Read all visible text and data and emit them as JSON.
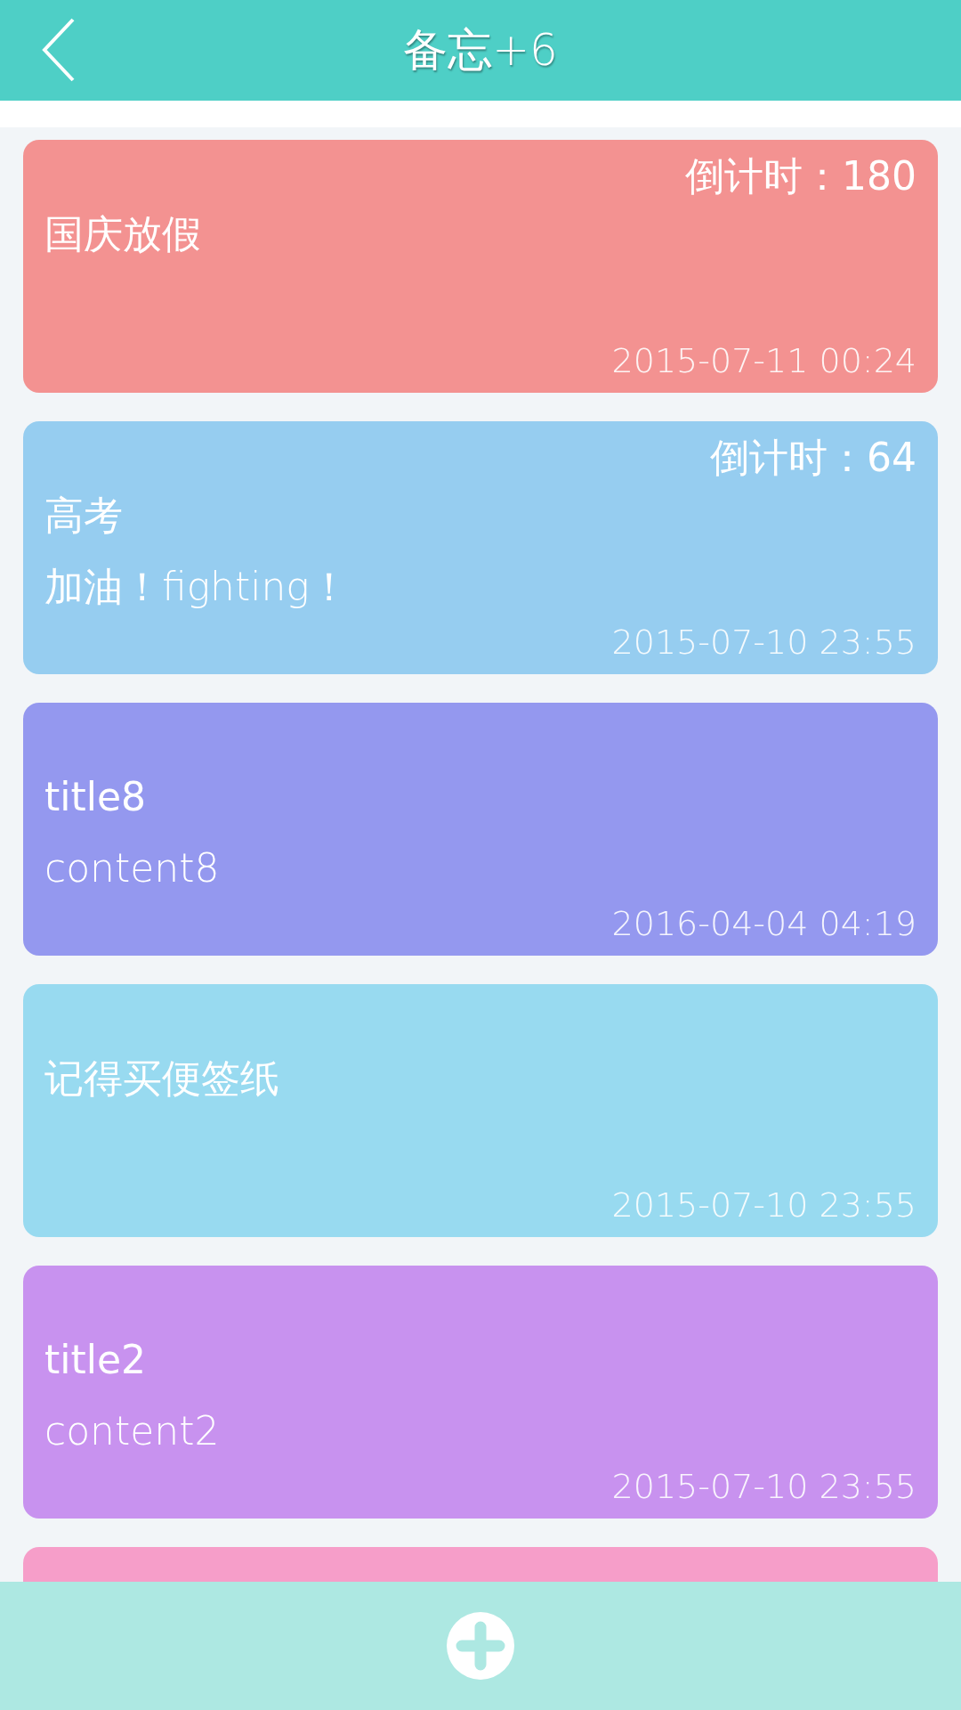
{
  "header": {
    "title": "备忘",
    "count": "+6"
  },
  "notes": [
    {
      "color": "#f39291",
      "countdown": "倒计时：180",
      "title": "国庆放假",
      "date": "2015-07-11 00:24"
    },
    {
      "color": "#96cdf0",
      "countdown": "倒计时：64",
      "title": "高考",
      "content": "加油！fighting！",
      "date": "2015-07-10 23:55"
    },
    {
      "color": "#9498ef",
      "title": "title8",
      "content": "content8",
      "date": "2016-04-04 04:19"
    },
    {
      "color": "#98daf0",
      "title": "记得买便签纸",
      "date": "2015-07-10 23:55"
    },
    {
      "color": "#c892ef",
      "title": "title2",
      "content": "content2",
      "date": "2015-07-10 23:55"
    },
    {
      "color": "#f69ec9"
    }
  ]
}
